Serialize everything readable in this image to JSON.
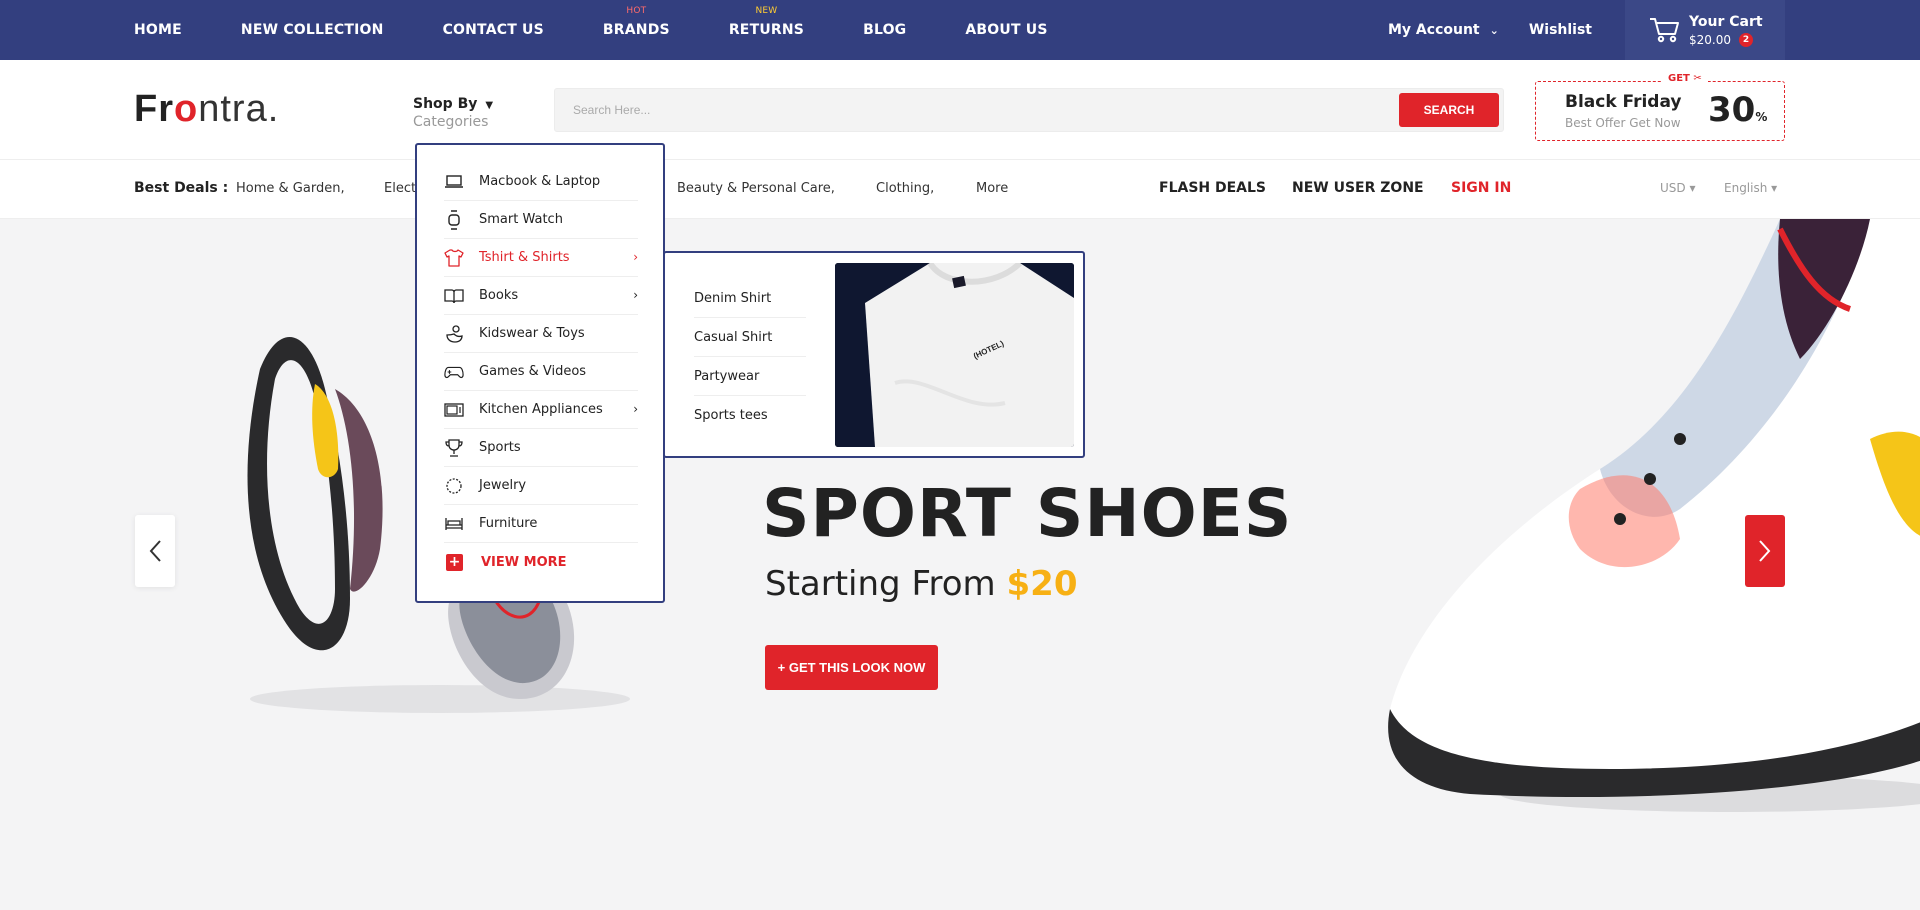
{
  "topbar": {
    "nav": [
      {
        "label": "HOME",
        "badge": ""
      },
      {
        "label": "NEW COLLECTION",
        "badge": ""
      },
      {
        "label": "CONTACT US",
        "badge": ""
      },
      {
        "label": "BRANDS",
        "badge": "HOT"
      },
      {
        "label": "RETURNS",
        "badge": "NEW"
      },
      {
        "label": "BLOG",
        "badge": ""
      },
      {
        "label": "ABOUT US",
        "badge": ""
      }
    ],
    "account": "My Account",
    "wishlist": "Wishlist",
    "cart": {
      "title": "Your Cart",
      "amount": "$20.00",
      "count": "2"
    }
  },
  "header": {
    "logo": {
      "part1": "Fr",
      "part2": "o",
      "part3": "ntra."
    },
    "shopby": {
      "title": "Shop By",
      "subtitle": "Categories"
    },
    "search": {
      "placeholder": "Search Here...",
      "button": "SEARCH"
    },
    "promo": {
      "get": "GET",
      "title": "Black Friday",
      "subtitle": "Best Offer Get Now",
      "value": "30",
      "unit": "%"
    }
  },
  "deals": {
    "label": "Best Deals :",
    "links": [
      "Home & Garden,",
      "Elect",
      "Beauty & Personal Care,",
      "Clothing,",
      "More"
    ],
    "flash": "FLASH DEALS",
    "newuser": "NEW USER ZONE",
    "signin": "SIGN IN",
    "currency": "USD",
    "language": "English"
  },
  "categories": {
    "items": [
      {
        "label": "Macbook & Laptop",
        "icon": "laptop-icon",
        "arrow": false
      },
      {
        "label": "Smart Watch",
        "icon": "watch-icon",
        "arrow": false
      },
      {
        "label": "Tshirt & Shirts",
        "icon": "tshirt-icon",
        "arrow": true
      },
      {
        "label": "Books",
        "icon": "book-icon",
        "arrow": true
      },
      {
        "label": "Kidswear & Toys",
        "icon": "toy-icon",
        "arrow": false
      },
      {
        "label": "Games & Videos",
        "icon": "gamepad-icon",
        "arrow": false
      },
      {
        "label": "Kitchen Appliances",
        "icon": "microwave-icon",
        "arrow": true
      },
      {
        "label": "Sports",
        "icon": "trophy-icon",
        "arrow": false
      },
      {
        "label": "Jewelry",
        "icon": "necklace-icon",
        "arrow": false
      },
      {
        "label": "Furniture",
        "icon": "bed-icon",
        "arrow": false
      }
    ],
    "more": "VIEW MORE",
    "submenu": [
      "Denim Shirt",
      "Casual Shirt",
      "Partywear",
      "Sports tees"
    ],
    "tshirt_print": "(HOTEL)"
  },
  "hero": {
    "title": "SPORT SHOES",
    "subtitle_prefix": "Starting From ",
    "price": "$20",
    "button": "+ GET THIS LOOK NOW"
  },
  "colors": {
    "navy": "#333f7f",
    "red": "#e0242a",
    "yellow": "#f7b014"
  }
}
